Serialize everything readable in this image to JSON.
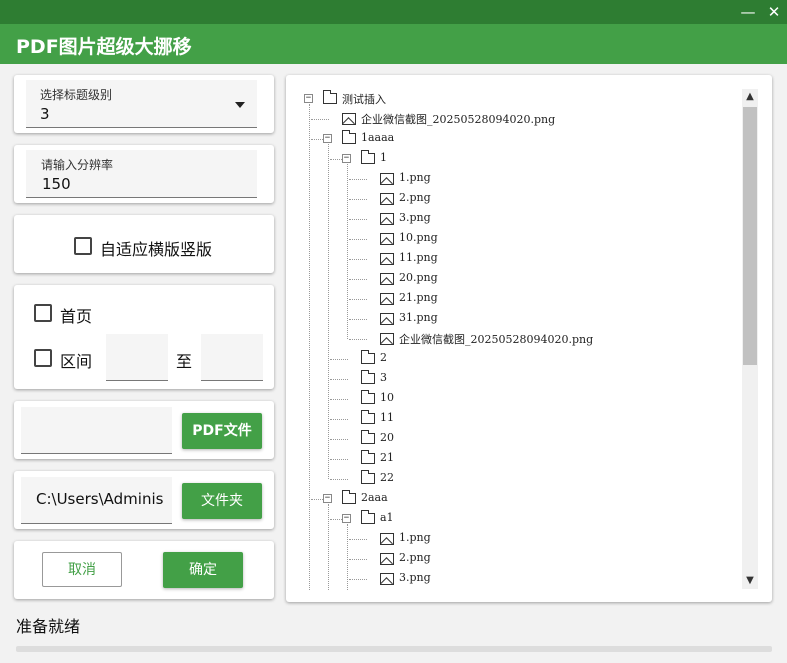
{
  "window": {
    "title": "PDF图片超级大挪移",
    "minimize": "—",
    "close": "✕"
  },
  "heading_level": {
    "label": "选择标题级别",
    "value": "3"
  },
  "resolution": {
    "label": "请输入分辨率",
    "value": "150"
  },
  "auto_orient": {
    "label": "自适应横版竖版",
    "checked": false
  },
  "pages": {
    "first_page_label": "首页",
    "range_label": "区间",
    "to_label": "至",
    "range_from": "",
    "range_to": ""
  },
  "pdf": {
    "path": "",
    "button": "PDF文件"
  },
  "folder": {
    "path": "C:\\Users\\Adminis",
    "button": "文件夹"
  },
  "actions": {
    "cancel": "取消",
    "ok": "确定"
  },
  "status": {
    "text": "准备就绪",
    "progress": 0
  },
  "tree": [
    {
      "label": "测试插入",
      "type": "folder",
      "depth": 0,
      "expanded": true
    },
    {
      "label": "企业微信截图_20250528094020.png",
      "type": "image",
      "depth": 1
    },
    {
      "label": "1aaaa",
      "type": "folder",
      "depth": 1,
      "expanded": true
    },
    {
      "label": "1",
      "type": "folder",
      "depth": 2,
      "expanded": true
    },
    {
      "label": "1.png",
      "type": "image",
      "depth": 3
    },
    {
      "label": "2.png",
      "type": "image",
      "depth": 3
    },
    {
      "label": "3.png",
      "type": "image",
      "depth": 3
    },
    {
      "label": "10.png",
      "type": "image",
      "depth": 3
    },
    {
      "label": "11.png",
      "type": "image",
      "depth": 3
    },
    {
      "label": "20.png",
      "type": "image",
      "depth": 3
    },
    {
      "label": "21.png",
      "type": "image",
      "depth": 3
    },
    {
      "label": "31.png",
      "type": "image",
      "depth": 3
    },
    {
      "label": "企业微信截图_20250528094020.png",
      "type": "image",
      "depth": 3
    },
    {
      "label": "2",
      "type": "folder",
      "depth": 2
    },
    {
      "label": "3",
      "type": "folder",
      "depth": 2
    },
    {
      "label": "10",
      "type": "folder",
      "depth": 2
    },
    {
      "label": "11",
      "type": "folder",
      "depth": 2
    },
    {
      "label": "20",
      "type": "folder",
      "depth": 2
    },
    {
      "label": "21",
      "type": "folder",
      "depth": 2
    },
    {
      "label": "22",
      "type": "folder",
      "depth": 2
    },
    {
      "label": "2aaa",
      "type": "folder",
      "depth": 1,
      "expanded": true
    },
    {
      "label": "a1",
      "type": "folder",
      "depth": 2,
      "expanded": true
    },
    {
      "label": "1.png",
      "type": "image",
      "depth": 3
    },
    {
      "label": "2.png",
      "type": "image",
      "depth": 3
    },
    {
      "label": "3.png",
      "type": "image",
      "depth": 3
    }
  ],
  "scrollbar": {
    "up_icon": "chevron-up-icon",
    "down_icon": "chevron-down-icon"
  },
  "colors": {
    "title_bar": "#43a047",
    "top_bar": "#2e7d32",
    "button": "#43a047"
  }
}
